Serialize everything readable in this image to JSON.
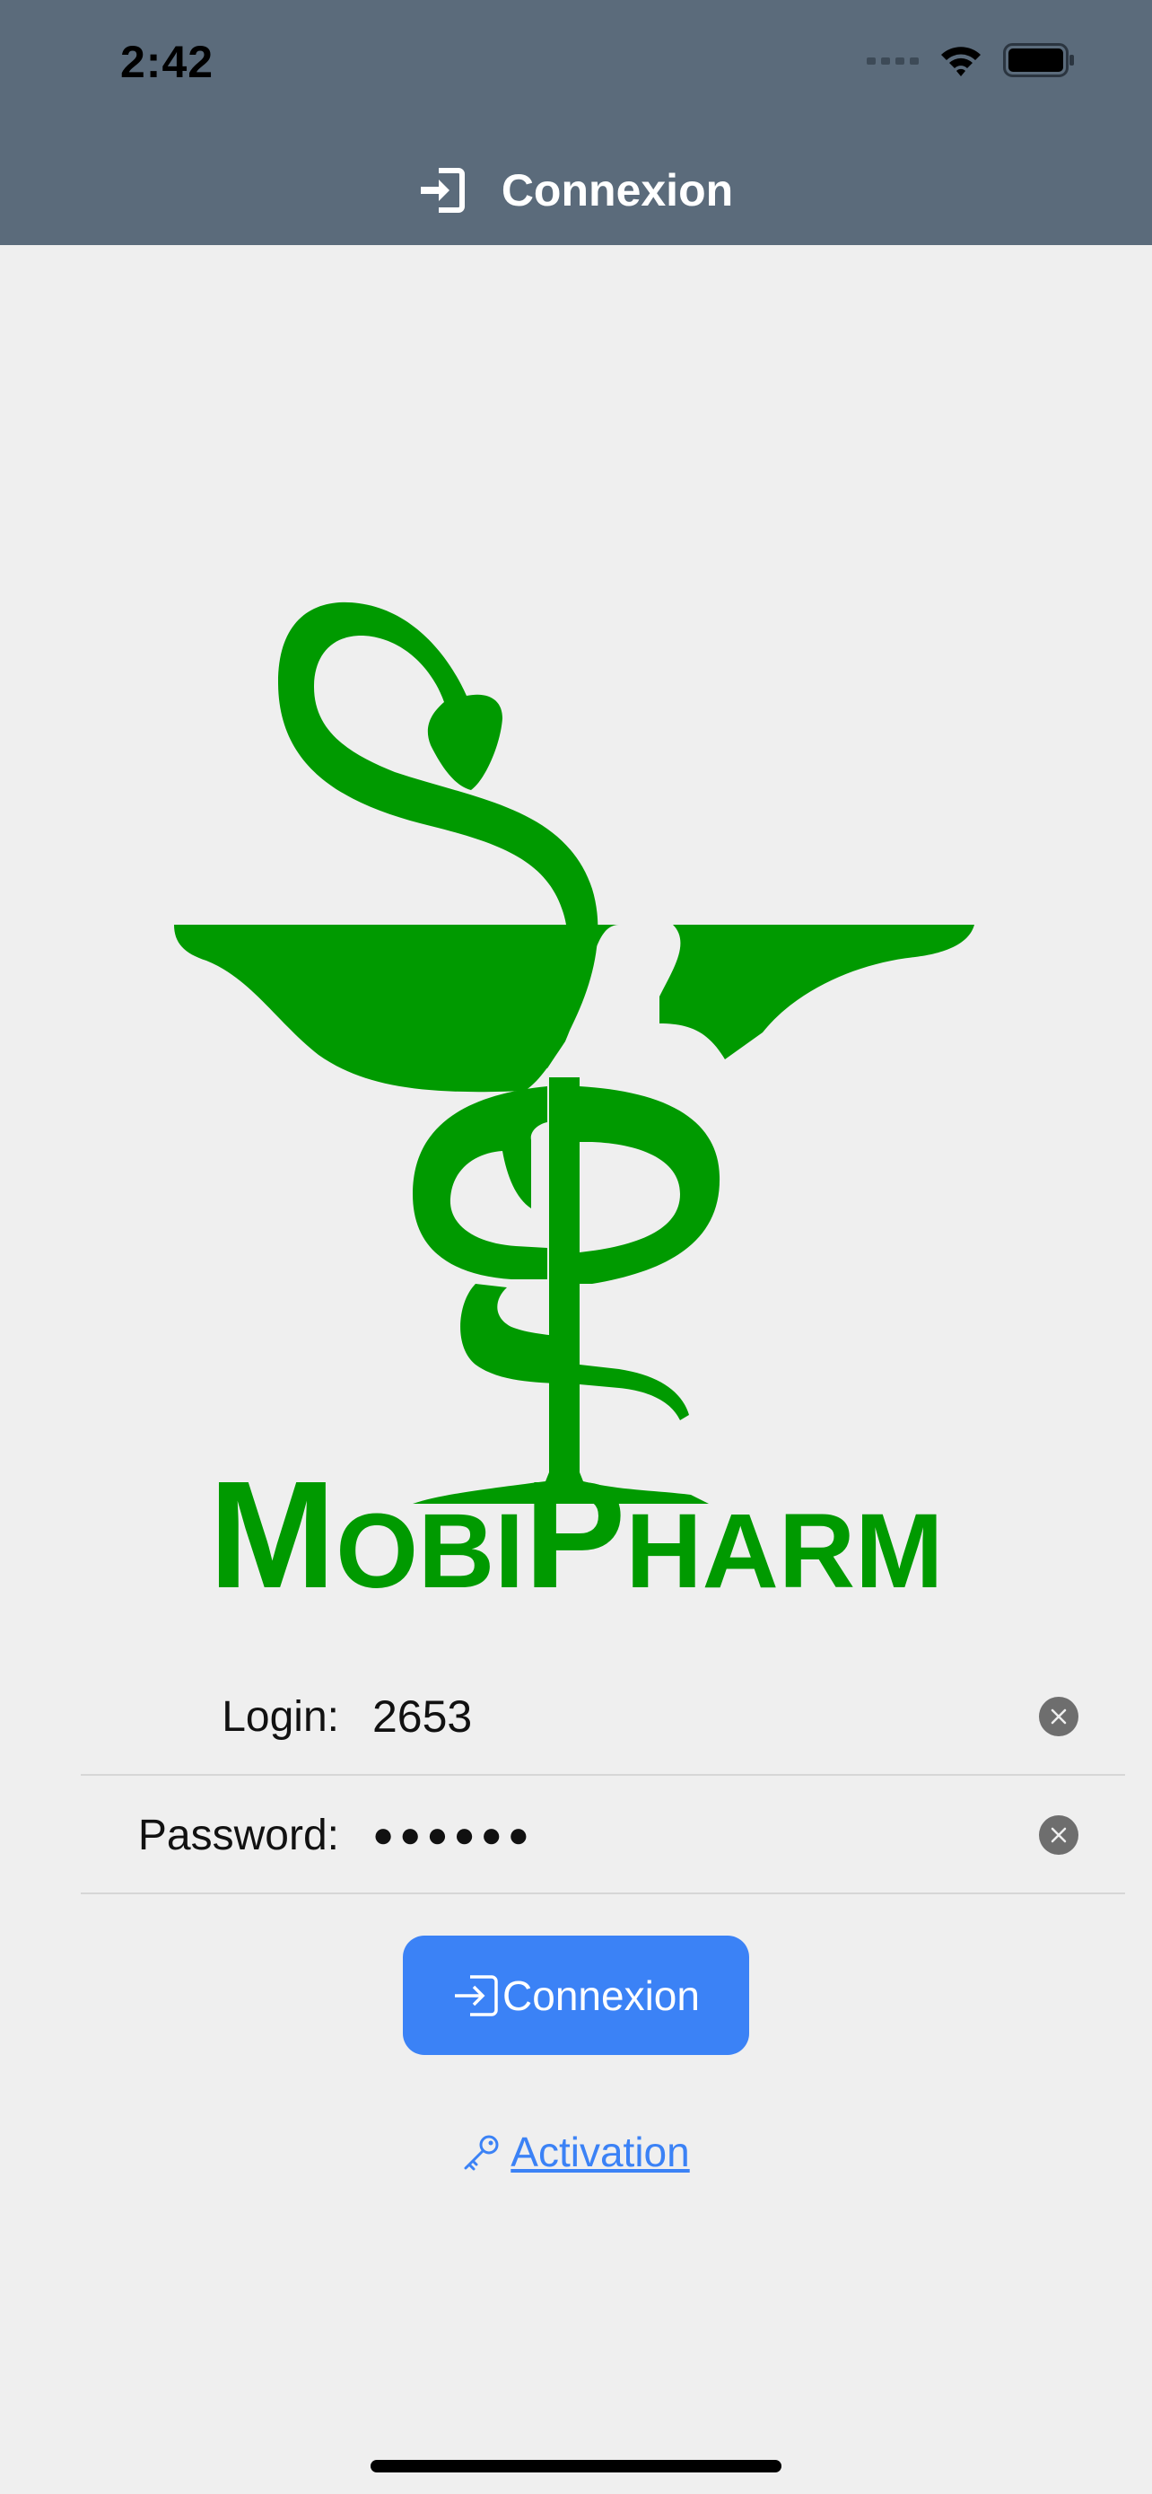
{
  "status_bar": {
    "time": "2:42",
    "icons": [
      "signal-icon",
      "wifi-icon",
      "battery-icon"
    ]
  },
  "nav": {
    "title": "Connexion",
    "icon": "login-icon"
  },
  "logo": {
    "brand_text": "MobiPharm",
    "color": "#009a00"
  },
  "form": {
    "login": {
      "label": "Login:",
      "value": "2653"
    },
    "password": {
      "label": "Password:",
      "value": "●●●●●●"
    }
  },
  "connect_button": {
    "label": "Connexion",
    "icon": "login-icon",
    "color": "#3b82f6"
  },
  "activation_link": {
    "label": " Activation",
    "icon": "key-icon"
  },
  "colors": {
    "header": "#5b6b7b",
    "background": "#efefef",
    "accent": "#3b82f6",
    "brand_green": "#009a00"
  }
}
